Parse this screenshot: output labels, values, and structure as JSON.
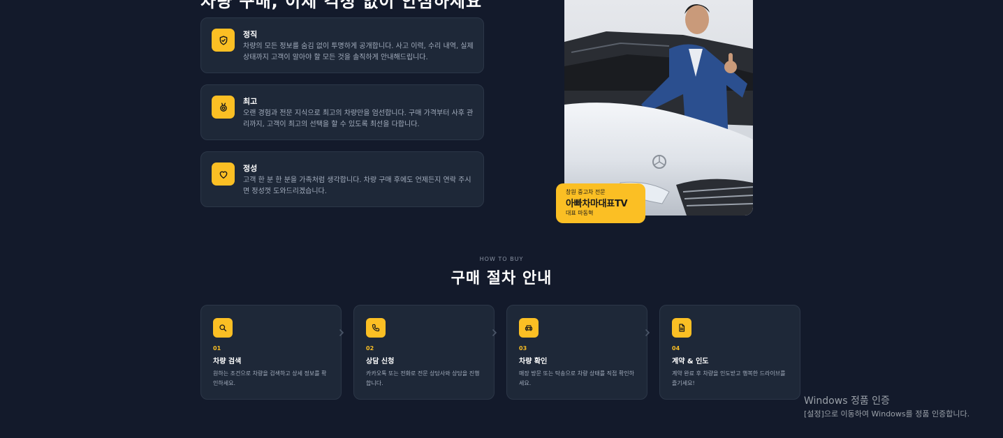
{
  "intro": {
    "heading": "차량 구매, 이제 걱정 없이 안심하세요"
  },
  "values": [
    {
      "icon": "shield-check-icon",
      "title": "정직",
      "desc": "차량의 모든 정보를 숨김 없이 투명하게 공개합니다. 사고 이력, 수리 내역, 실제 상태까지 고객이 알아야 할 모든 것을 솔직하게 안내해드립니다."
    },
    {
      "icon": "medal-icon",
      "title": "최고",
      "desc": "오랜 경험과 전문 지식으로 최고의 차량만을 엄선합니다. 구매 가격부터 사후 관리까지, 고객이 최고의 선택을 할 수 있도록 최선을 다합니다."
    },
    {
      "icon": "heart-icon",
      "title": "정성",
      "desc": "고객 한 분 한 분을 가족처럼 생각합니다. 차량 구매 후에도 언제든지 연락 주시면 정성껏 도와드리겠습니다."
    }
  ],
  "badge": {
    "sub": "창원 중고차 전문",
    "name": "아빠차마대표TV",
    "rep": "대표 마동혁"
  },
  "process": {
    "eyebrow": "HOW TO BUY",
    "title": "구매 절차 안내",
    "steps": [
      {
        "icon": "search-icon",
        "num": "01",
        "title": "차량 검색",
        "desc": "원하는 조건으로 차량을 검색하고 상세 정보를 확인하세요."
      },
      {
        "icon": "phone-icon",
        "num": "02",
        "title": "상담 신청",
        "desc": "카카오톡 또는 전화로 전문 상담사와 상담을 진행합니다."
      },
      {
        "icon": "car-icon",
        "num": "03",
        "title": "차량 확인",
        "desc": "매장 방문 또는 탁송으로 차량 상태를 직접 확인하세요."
      },
      {
        "icon": "document-icon",
        "num": "04",
        "title": "계약 & 인도",
        "desc": "계약 완료 후 차량을 인도받고 행복한 드라이브를 즐기세요!"
      }
    ]
  },
  "activation": {
    "title": "Windows 정품 인증",
    "sub": "[설정]으로 이동하여 Windows를 정품 인증합니다."
  },
  "colors": {
    "background": "#131a2b",
    "card": "#1e2838",
    "accent": "#fbbf24"
  }
}
